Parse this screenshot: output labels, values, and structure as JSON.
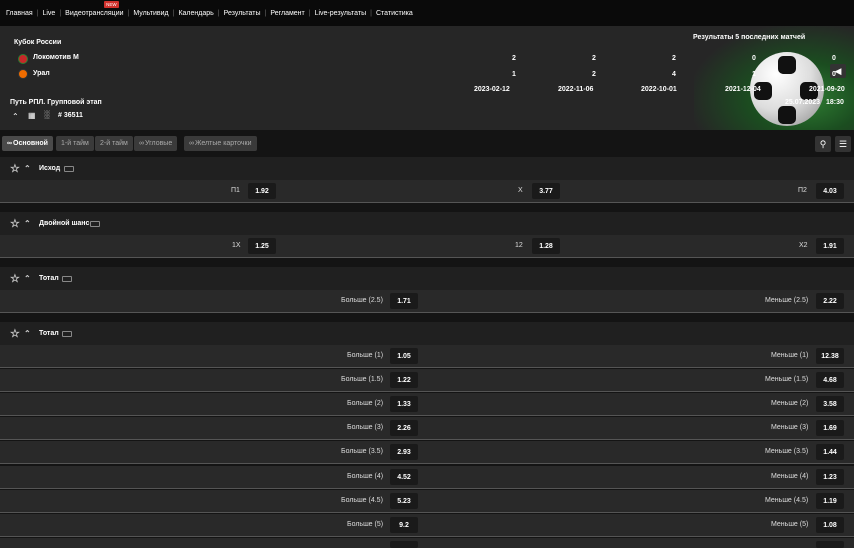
{
  "nav": {
    "items": [
      "Главная",
      "Live",
      "Видеотрансляции",
      "Мультивид",
      "Календарь",
      "Результаты",
      "Регламент",
      "Live-результаты",
      "Статистика"
    ],
    "new_badge": "NEW"
  },
  "match": {
    "tournament": "Кубок России",
    "team1": "Локомотив М",
    "team2": "Урал",
    "stage": "Путь РПЛ. Групповой этап",
    "event_id": "# 36511",
    "date": "25.07.2023",
    "time": "18:30",
    "results_title": "Результаты 5 последних матчей",
    "team1_scores": [
      "2",
      "2",
      "2",
      "0",
      "0"
    ],
    "team2_scores": [
      "1",
      "2",
      "4",
      "1",
      "0"
    ],
    "dates": [
      "2023-02-12",
      "2022-11-06",
      "2022-10-01",
      "2021-12-04",
      "2021-09-20"
    ]
  },
  "tabs": [
    "Основной",
    "1-й тайм",
    "2-й тайм",
    "Угловые",
    "Желтые карточки"
  ],
  "sections": {
    "outcome": {
      "title": "Исход",
      "labels": [
        "П1",
        "X",
        "П2"
      ],
      "odds": [
        "1.92",
        "3.77",
        "4.03"
      ]
    },
    "double": {
      "title": "Двойной шанс",
      "labels": [
        "1X",
        "12",
        "X2"
      ],
      "odds": [
        "1.25",
        "1.28",
        "1.91"
      ]
    },
    "total1": {
      "title": "Тотал",
      "labels": [
        "Больше (2.5)",
        "Меньше (2.5)"
      ],
      "odds": [
        "1.71",
        "2.22"
      ]
    },
    "total2": {
      "title": "Тотал",
      "rows": [
        {
          "over": "Больше (1)",
          "over_odd": "1.05",
          "under": "Меньше (1)",
          "under_odd": "12.38"
        },
        {
          "over": "Больше (1.5)",
          "over_odd": "1.22",
          "under": "Меньше (1.5)",
          "under_odd": "4.68"
        },
        {
          "over": "Больше (2)",
          "over_odd": "1.33",
          "under": "Меньше (2)",
          "under_odd": "3.58"
        },
        {
          "over": "Больше (3)",
          "over_odd": "2.26",
          "under": "Меньше (3)",
          "under_odd": "1.69"
        },
        {
          "over": "Больше (3.5)",
          "over_odd": "2.93",
          "under": "Меньше (3.5)",
          "under_odd": "1.44"
        },
        {
          "over": "Больше (4)",
          "over_odd": "4.52",
          "under": "Меньше (4)",
          "under_odd": "1.23"
        },
        {
          "over": "Больше (4.5)",
          "over_odd": "5.23",
          "under": "Меньше (4.5)",
          "under_odd": "1.19"
        },
        {
          "over": "Больше (5)",
          "over_odd": "9.2",
          "under": "Меньше (5)",
          "under_odd": "1.08"
        }
      ]
    }
  }
}
